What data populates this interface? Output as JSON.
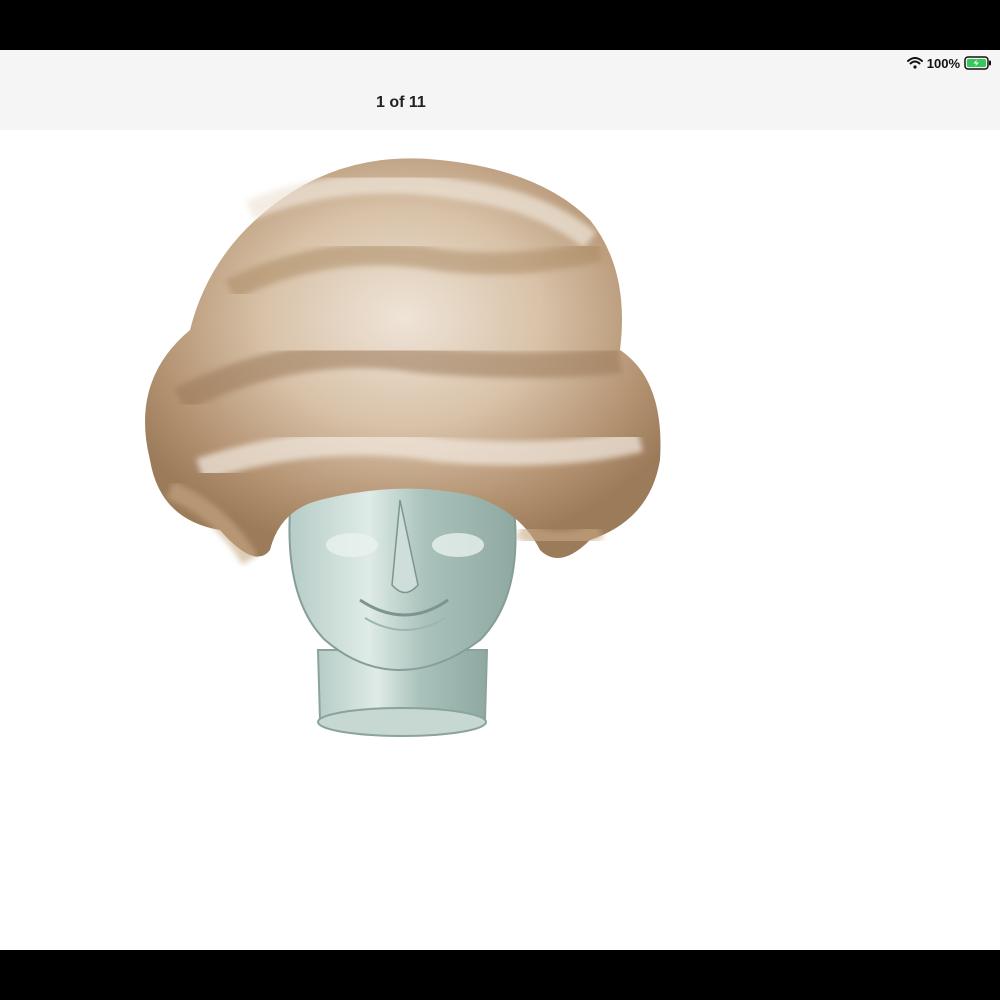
{
  "status_bar": {
    "battery_percent": "100%",
    "battery_level": 1.0,
    "icons": [
      "wifi-icon",
      "battery-charging-icon"
    ],
    "battery_color": "#34c759"
  },
  "viewer": {
    "counter": "1 of 11"
  }
}
